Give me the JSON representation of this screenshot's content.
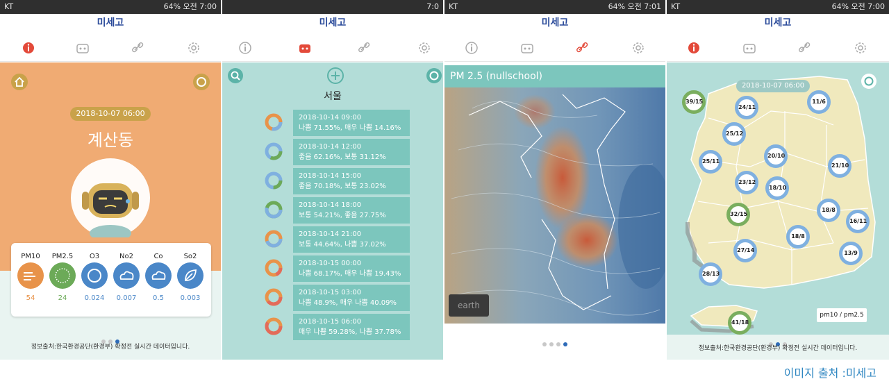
{
  "common": {
    "app_title": "미세고"
  },
  "screen1": {
    "status_left": "KT",
    "status_right": "64% 오전 7:00",
    "date": "2018-10-07 06:00",
    "location": "계산동",
    "pollutants": [
      {
        "name": "PM10",
        "value": "54",
        "color": "#e8934a"
      },
      {
        "name": "PM2.5",
        "value": "24",
        "color": "#6caa58"
      },
      {
        "name": "O3",
        "value": "0.024",
        "color": "#4a87c8"
      },
      {
        "name": "No2",
        "value": "0.007",
        "color": "#4a87c8"
      },
      {
        "name": "Co",
        "value": "0.5",
        "color": "#4a87c8"
      },
      {
        "name": "So2",
        "value": "0.003",
        "color": "#4a87c8"
      }
    ],
    "source": "정보출처:한국환경공단(환경부) 확정전 실시간 데이터입니다."
  },
  "screen2": {
    "status_right": "7:0",
    "city": "서울",
    "forecasts": [
      {
        "time": "2018-10-14 09:00",
        "detail": "나쁨 71.55%, 매우 나쁨 14.16%"
      },
      {
        "time": "2018-10-14 12:00",
        "detail": "좋음 62.16%, 보통 31.12%"
      },
      {
        "time": "2018-10-14 15:00",
        "detail": "좋음 70.18%, 보통 23.02%"
      },
      {
        "time": "2018-10-14 18:00",
        "detail": "보통 54.21%, 좋음 27.75%"
      },
      {
        "time": "2018-10-14 21:00",
        "detail": "보통 44.64%, 나쁨 37.02%"
      },
      {
        "time": "2018-10-15 00:00",
        "detail": "나쁨 68.17%, 매우 나쁨 19.43%"
      },
      {
        "time": "2018-10-15 03:00",
        "detail": "나쁨 48.9%, 매우 나쁨 40.09%"
      },
      {
        "time": "2018-10-15 06:00",
        "detail": "매우 나쁨 59.28%, 나쁨 37.78%"
      }
    ]
  },
  "screen3": {
    "status_left": "KT",
    "status_right": "64% 오전 7:01",
    "map_title": "PM 2.5 (nullschool)",
    "earth_label": "earth"
  },
  "screen4": {
    "status_left": "KT",
    "status_right": "64% 오전 7:00",
    "date": "2018-10-07 06:00",
    "legend": "pm10 / pm2.5",
    "regions": [
      {
        "label": "39/15",
        "green": true
      },
      {
        "label": "24/11",
        "green": false
      },
      {
        "label": "11/6",
        "green": false
      },
      {
        "label": "25/12",
        "green": false
      },
      {
        "label": "20/10",
        "green": false
      },
      {
        "label": "25/11",
        "green": false
      },
      {
        "label": "21/10",
        "green": false
      },
      {
        "label": "23/12",
        "green": false
      },
      {
        "label": "18/10",
        "green": false
      },
      {
        "label": "32/15",
        "green": true
      },
      {
        "label": "18/8",
        "green": false
      },
      {
        "label": "16/11",
        "green": false
      },
      {
        "label": "18/8",
        "green": false
      },
      {
        "label": "27/14",
        "green": false
      },
      {
        "label": "13/9",
        "green": false
      },
      {
        "label": "28/13",
        "green": false
      },
      {
        "label": "41/18",
        "green": true
      }
    ],
    "source": "정보출처:한국환경공단(환경부) 확정전 실시간 데이터입니다."
  },
  "caption": "이미지 출처 :미세고"
}
